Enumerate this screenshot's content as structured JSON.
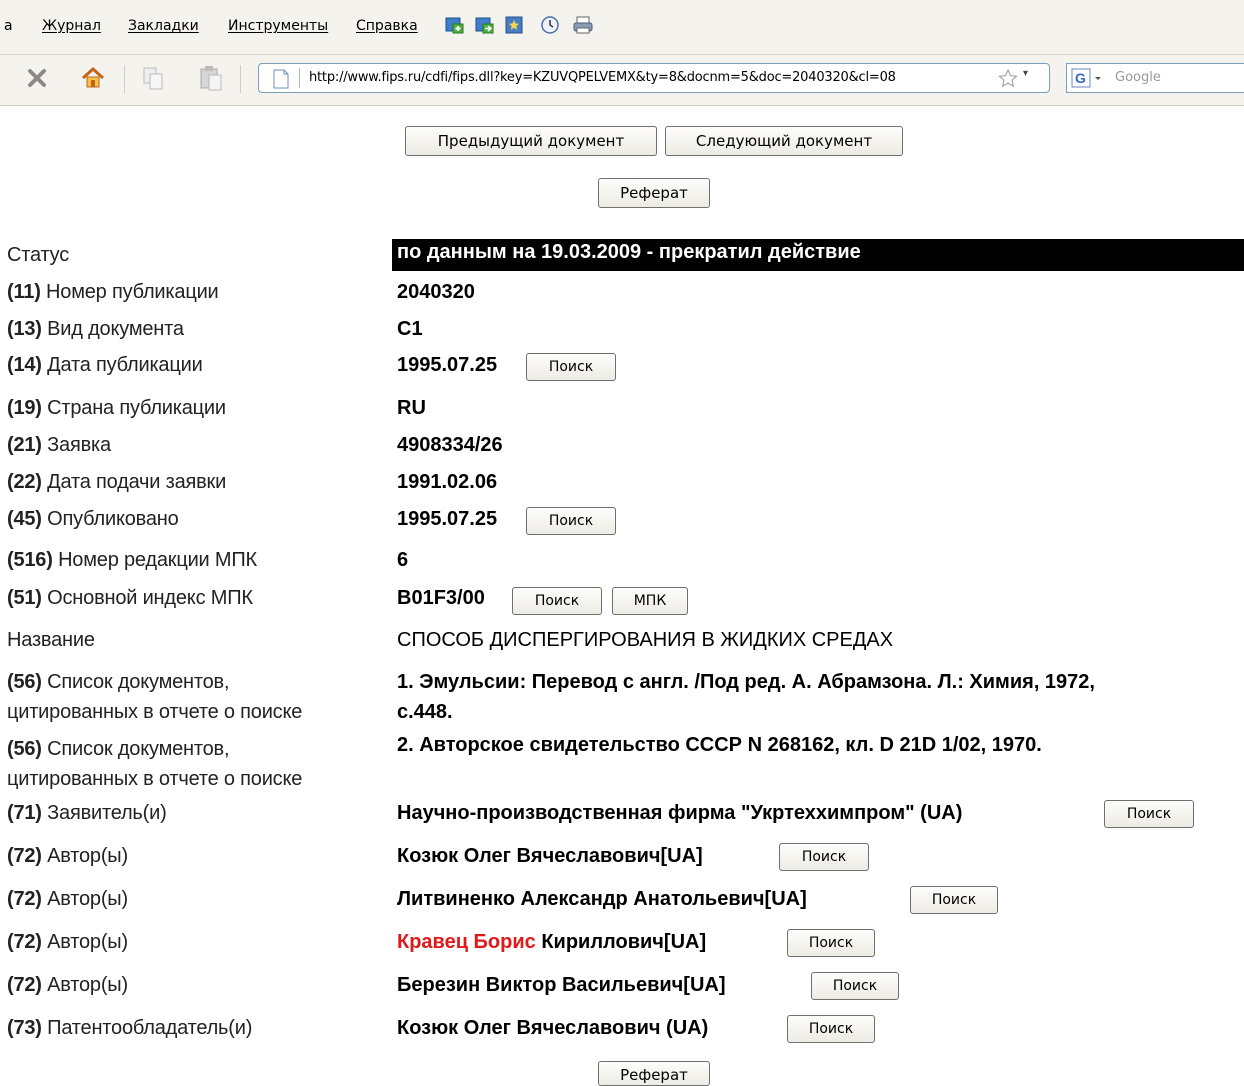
{
  "browser": {
    "menu": {
      "partial": "а",
      "journal": "Журнал",
      "bookmarks": "Закладки",
      "tools": "Инструменты",
      "help": "Справка"
    },
    "url": "http://www.fips.ru/cdfi/fips.dll?key=KZUVQPELVEMX&ty=8&docnm=5&doc=2040320&cl=08",
    "search_placeholder": "Google"
  },
  "nav": {
    "prev_doc": "Предыдущий документ",
    "next_doc": "Следующий документ",
    "abstract_top": "Реферат",
    "abstract_bottom": "Реферат"
  },
  "buttons": {
    "search": "Поиск",
    "mpk": "МПК"
  },
  "record": {
    "status": {
      "label": "Статус",
      "value": "по данным на 19.03.2009 - прекратил действие"
    },
    "pub_number": {
      "code": "(11)",
      "label": "Номер публикации",
      "value": "2040320"
    },
    "doc_type": {
      "code": "(13)",
      "label": "Вид документа",
      "value": "C1"
    },
    "pub_date": {
      "code": "(14)",
      "label": "Дата публикации",
      "value": "1995.07.25"
    },
    "country": {
      "code": "(19)",
      "label": "Страна публикации",
      "value": "RU"
    },
    "application": {
      "code": "(21)",
      "label": "Заявка",
      "value": "4908334/26"
    },
    "filing_date": {
      "code": "(22)",
      "label": "Дата подачи заявки",
      "value": "1991.02.06"
    },
    "published": {
      "code": "(45)",
      "label": "Опубликовано",
      "value": "1995.07.25"
    },
    "ipc_edition": {
      "code": "(516)",
      "label": "Номер редакции МПК",
      "value": "6"
    },
    "ipc_main": {
      "code": "(51)",
      "label": "Основной индекс МПК",
      "value": "B01F3/00"
    },
    "title": {
      "label": "Название",
      "value": "СПОСОБ ДИСПЕРГИРОВАНИЯ В ЖИДКИХ СРЕДАХ"
    },
    "cited_1": {
      "code": "(56)",
      "label_line1": "Список документов,",
      "label_line2": "цитированных в отчете о поиске",
      "value_line1": "1. Эмульсии: Перевод с англ. /Под ред. А. Абрамзона. Л.: Химия, 1972,",
      "value_line2": "с.448."
    },
    "cited_2": {
      "code": "(56)",
      "label_line1": "Список документов,",
      "label_line2": "цитированных в отчете о поиске",
      "value": "2. Авторское свидетельство СССР N 268162, кл. D 21D 1/02, 1970."
    },
    "applicant": {
      "code": "(71)",
      "label": "Заявитель(и)",
      "value": "Научно-производственная фирма \"Укртеххимпром\" (UA)"
    },
    "authors": [
      {
        "code": "(72)",
        "label": "Автор(ы)",
        "value": "Козюк Олег Вячеславович[UA]"
      },
      {
        "code": "(72)",
        "label": "Автор(ы)",
        "value": "Литвиненко Александр Анатольевич[UA]"
      },
      {
        "code": "(72)",
        "label": "Автор(ы)",
        "value_highlight": "Кравец Борис",
        "value_rest": " Кириллович[UA]"
      },
      {
        "code": "(72)",
        "label": "Автор(ы)",
        "value": "Березин Виктор Васильевич[UA]"
      }
    ],
    "patent_holder": {
      "code": "(73)",
      "label": "Патентообладатель(и)",
      "value": "Козюк Олег Вячеславович (UA)"
    }
  }
}
